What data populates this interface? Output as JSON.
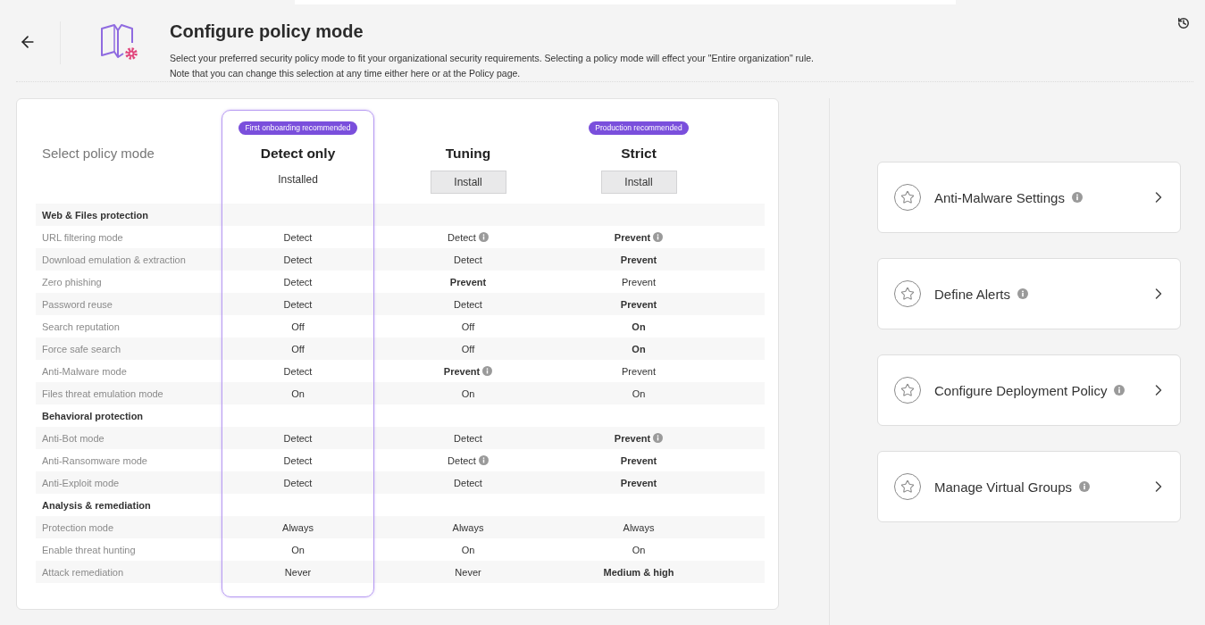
{
  "header": {
    "title": "Configure policy mode",
    "description": [
      "Select your preferred security policy mode to fit your organizational security requirements. Selecting a policy mode will effect your \"Entire organization\" rule.",
      "Note that you can change this selection at any time either here or at the Policy page."
    ]
  },
  "policy_table": {
    "label_heading": "Select policy mode",
    "modes": [
      {
        "name": "Detect only",
        "badge": "First onboarding recommended",
        "status": "Installed",
        "installed": true,
        "selected": true
      },
      {
        "name": "Tuning",
        "status": "Install",
        "installed": false,
        "selected": false
      },
      {
        "name": "Strict",
        "badge": "Production recommended",
        "status": "Install",
        "installed": false,
        "selected": false
      }
    ],
    "sections": [
      {
        "title": "Web & Files protection",
        "rows": [
          {
            "label": "URL filtering mode",
            "values": [
              {
                "text": "Detect",
                "bold": false,
                "info": false
              },
              {
                "text": "Detect",
                "bold": false,
                "info": true
              },
              {
                "text": "Prevent",
                "bold": true,
                "info": true
              }
            ]
          },
          {
            "label": "Download emulation & extraction",
            "values": [
              {
                "text": "Detect",
                "bold": false,
                "info": false
              },
              {
                "text": "Detect",
                "bold": false,
                "info": false
              },
              {
                "text": "Prevent",
                "bold": true,
                "info": false
              }
            ]
          },
          {
            "label": "Zero phishing",
            "values": [
              {
                "text": "Detect",
                "bold": false,
                "info": false
              },
              {
                "text": "Prevent",
                "bold": true,
                "info": false
              },
              {
                "text": "Prevent",
                "bold": false,
                "info": false
              }
            ]
          },
          {
            "label": "Password reuse",
            "values": [
              {
                "text": "Detect",
                "bold": false,
                "info": false
              },
              {
                "text": "Detect",
                "bold": false,
                "info": false
              },
              {
                "text": "Prevent",
                "bold": true,
                "info": false
              }
            ]
          },
          {
            "label": "Search reputation",
            "values": [
              {
                "text": "Off",
                "bold": false,
                "info": false
              },
              {
                "text": "Off",
                "bold": false,
                "info": false
              },
              {
                "text": "On",
                "bold": true,
                "info": false
              }
            ]
          },
          {
            "label": "Force safe search",
            "values": [
              {
                "text": "Off",
                "bold": false,
                "info": false
              },
              {
                "text": "Off",
                "bold": false,
                "info": false
              },
              {
                "text": "On",
                "bold": true,
                "info": false
              }
            ]
          },
          {
            "label": "Anti-Malware mode",
            "values": [
              {
                "text": "Detect",
                "bold": false,
                "info": false
              },
              {
                "text": "Prevent",
                "bold": true,
                "info": true
              },
              {
                "text": "Prevent",
                "bold": false,
                "info": false
              }
            ]
          },
          {
            "label": "Files threat emulation mode",
            "values": [
              {
                "text": "On",
                "bold": false,
                "info": false
              },
              {
                "text": "On",
                "bold": false,
                "info": false
              },
              {
                "text": "On",
                "bold": false,
                "info": false
              }
            ]
          }
        ]
      },
      {
        "title": "Behavioral protection",
        "rows": [
          {
            "label": "Anti-Bot mode",
            "values": [
              {
                "text": "Detect",
                "bold": false,
                "info": false
              },
              {
                "text": "Detect",
                "bold": false,
                "info": false
              },
              {
                "text": "Prevent",
                "bold": true,
                "info": true
              }
            ]
          },
          {
            "label": "Anti-Ransomware mode",
            "values": [
              {
                "text": "Detect",
                "bold": false,
                "info": false
              },
              {
                "text": "Detect",
                "bold": false,
                "info": true
              },
              {
                "text": "Prevent",
                "bold": true,
                "info": false
              }
            ]
          },
          {
            "label": "Anti-Exploit mode",
            "values": [
              {
                "text": "Detect",
                "bold": false,
                "info": false
              },
              {
                "text": "Detect",
                "bold": false,
                "info": false
              },
              {
                "text": "Prevent",
                "bold": true,
                "info": false
              }
            ]
          }
        ]
      },
      {
        "title": "Analysis & remediation",
        "rows": [
          {
            "label": "Protection mode",
            "values": [
              {
                "text": "Always",
                "bold": false,
                "info": false
              },
              {
                "text": "Always",
                "bold": false,
                "info": false
              },
              {
                "text": "Always",
                "bold": false,
                "info": false
              }
            ]
          },
          {
            "label": "Enable threat hunting",
            "values": [
              {
                "text": "On",
                "bold": false,
                "info": false
              },
              {
                "text": "On",
                "bold": false,
                "info": false
              },
              {
                "text": "On",
                "bold": false,
                "info": false
              }
            ]
          },
          {
            "label": "Attack remediation",
            "values": [
              {
                "text": "Never",
                "bold": false,
                "info": false
              },
              {
                "text": "Never",
                "bold": false,
                "info": false
              },
              {
                "text": "Medium & high",
                "bold": true,
                "info": false
              }
            ]
          }
        ]
      }
    ]
  },
  "shortcuts": [
    {
      "title": "Anti-Malware Settings"
    },
    {
      "title": "Define Alerts"
    },
    {
      "title": "Configure Deployment Policy"
    },
    {
      "title": "Manage Virtual Groups"
    }
  ]
}
